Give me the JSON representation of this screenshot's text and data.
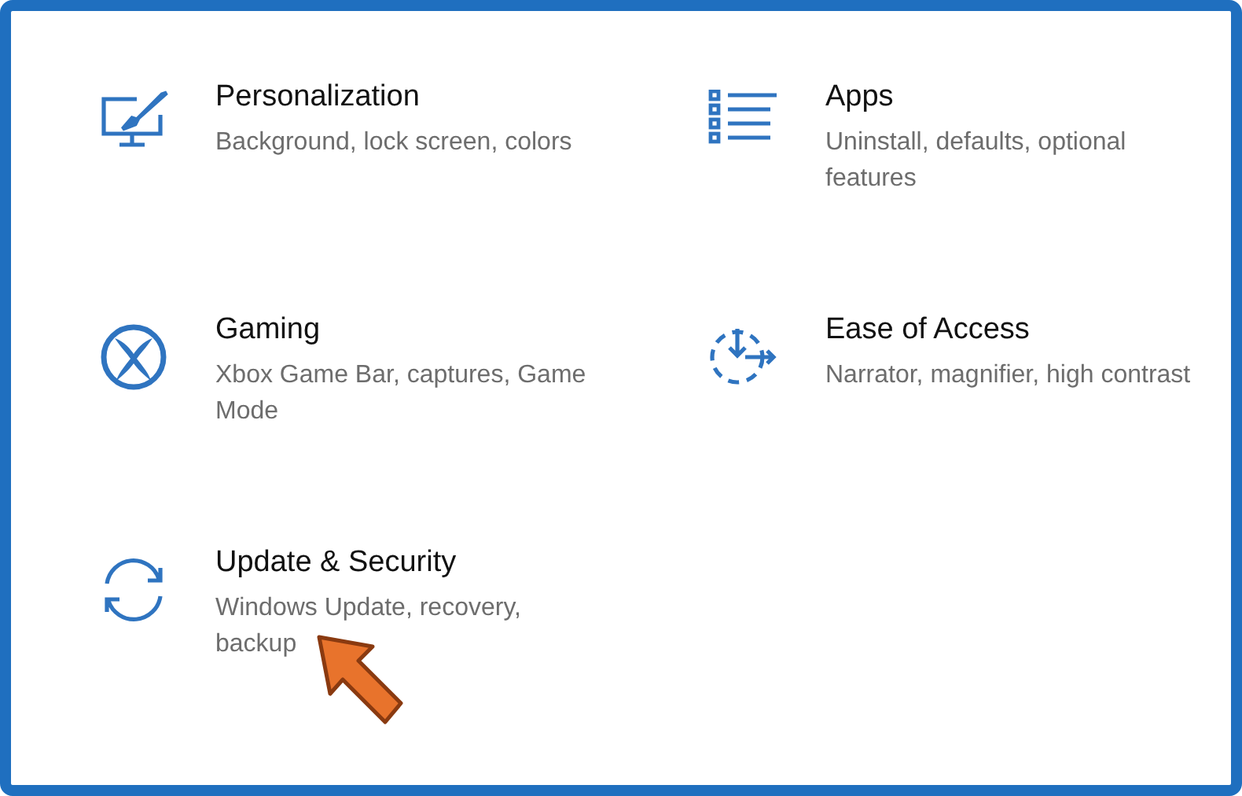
{
  "tiles": [
    {
      "kind": "personalization",
      "title": "Personalization",
      "description": "Background, lock screen, colors"
    },
    {
      "kind": "apps",
      "title": "Apps",
      "description": "Uninstall, defaults, optional features"
    },
    {
      "kind": "gaming",
      "title": "Gaming",
      "description": "Xbox Game Bar, captures, Game Mode"
    },
    {
      "kind": "ease",
      "title": "Ease of Access",
      "description": "Narrator, magnifier, high contrast"
    },
    {
      "kind": "update",
      "title": "Update & Security",
      "description": "Windows Update, recovery, backup"
    }
  ]
}
